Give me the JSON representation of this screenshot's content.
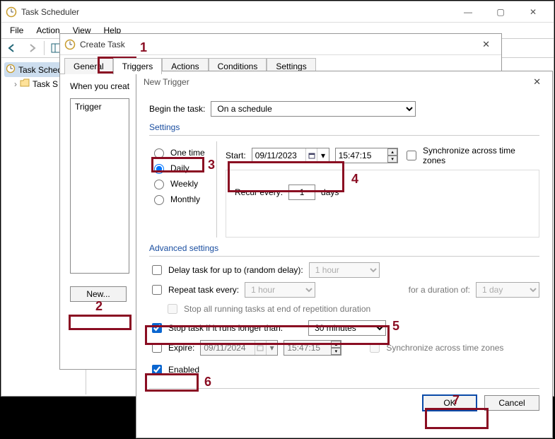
{
  "main_window": {
    "title": "Task Scheduler",
    "menu": {
      "file": "File",
      "action": "Action",
      "view": "View",
      "help": "Help"
    },
    "tree": {
      "root": "Task Sched",
      "child": "Task S"
    }
  },
  "create_task": {
    "title": "Create Task",
    "tabs": {
      "general": "General",
      "triggers": "Triggers",
      "actions": "Actions",
      "conditions": "Conditions",
      "settings": "Settings"
    },
    "intro": "When you creat",
    "list_header": "Trigger",
    "new_button": "New..."
  },
  "new_trigger": {
    "title": "New Trigger",
    "begin_label": "Begin the task:",
    "begin_value": "On a schedule",
    "settings_title": "Settings",
    "freq": {
      "one_time": "One time",
      "daily": "Daily",
      "weekly": "Weekly",
      "monthly": "Monthly"
    },
    "start_label": "Start:",
    "start_date": "09/11/2023",
    "start_time": "15:47:15",
    "sync_tz": "Synchronize across time zones",
    "recur_label": "Recur every:",
    "recur_value": "1",
    "recur_unit": "days",
    "advanced_title": "Advanced settings",
    "delay_label": "Delay task for up to (random delay):",
    "delay_value": "1 hour",
    "repeat_label": "Repeat task every:",
    "repeat_value": "1 hour",
    "repeat_dur_label": "for a duration of:",
    "repeat_dur_value": "1 day",
    "stop_all_label": "Stop all running tasks at end of repetition duration",
    "stop_long_label": "Stop task if it runs longer than:",
    "stop_long_value": "30 minutes",
    "expire_label": "Expire:",
    "expire_date": "09/11/2024",
    "expire_time": "15:47:15",
    "enabled_label": "Enabled",
    "ok": "OK",
    "cancel": "Cancel"
  },
  "annotations": {
    "n1": "1",
    "n2": "2",
    "n3": "3",
    "n4": "4",
    "n5": "5",
    "n6": "6",
    "n7": "7"
  }
}
